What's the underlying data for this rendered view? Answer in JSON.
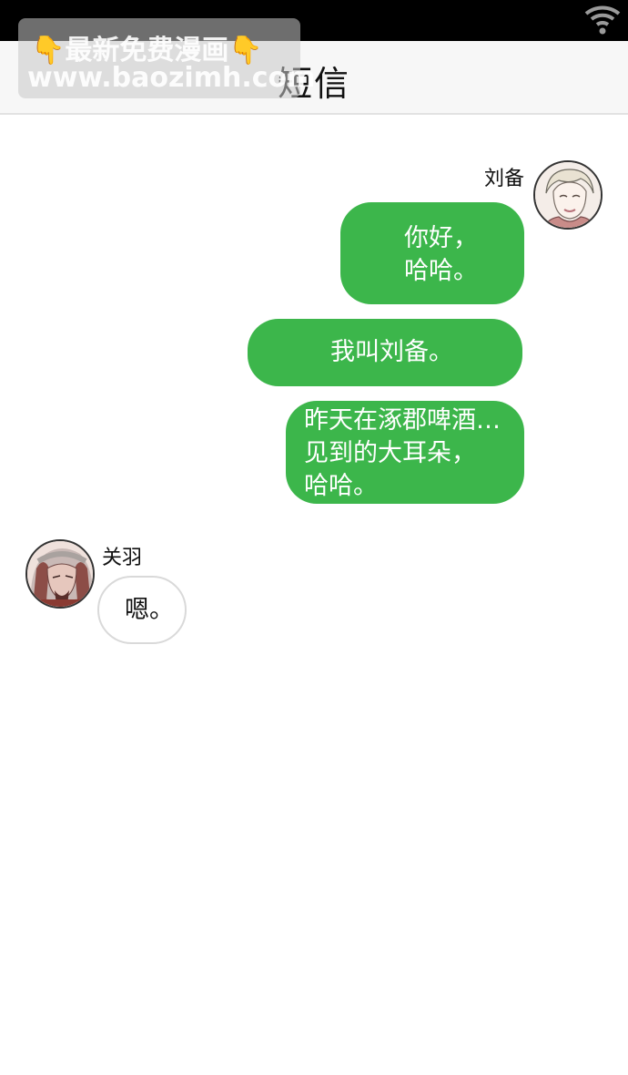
{
  "header": {
    "title": "短信"
  },
  "watermark": {
    "line1": "最新免费漫画",
    "line2": "www.baozimh.com",
    "hand_glyph": "👇"
  },
  "messages": {
    "outgoing_sender": "刘备",
    "incoming_sender": "关羽",
    "m1": [
      "你好，",
      "哈哈。"
    ],
    "m2": [
      "我叫刘备。"
    ],
    "m3": [
      "昨天在涿郡啤酒…",
      "见到的大耳朵，",
      "哈哈。"
    ],
    "m4": [
      "嗯。"
    ]
  },
  "colors": {
    "outgoing_bubble": "#3cb64b",
    "status_bar": "#000000",
    "header_bg": "#f7f7f7"
  },
  "icons": {
    "wifi": "wifi-icon",
    "liubei_avatar": "avatar-liubei",
    "guanyu_avatar": "avatar-guanyu"
  }
}
